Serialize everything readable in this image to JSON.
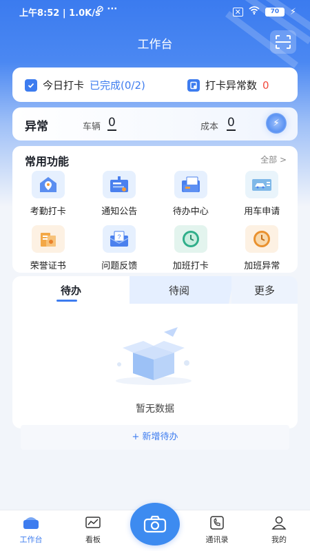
{
  "status_bar": {
    "time_speed": "上午8:52 | 1.0K/s",
    "battery": "70"
  },
  "header": {
    "title": "工作台"
  },
  "checkin": {
    "today_label": "今日打卡",
    "today_status": "已完成(0/2)",
    "abnormal_label": "打卡异常数",
    "abnormal_count": "0"
  },
  "abnormal": {
    "title": "异常",
    "vehicle_label": "车辆",
    "vehicle_value": "0",
    "cost_label": "成本",
    "cost_value": "0"
  },
  "functions": {
    "title": "常用功能",
    "all_label": "全部 >",
    "items": [
      {
        "label": "考勤打卡",
        "icon": "location-pin-icon"
      },
      {
        "label": "通知公告",
        "icon": "notice-board-icon"
      },
      {
        "label": "待办中心",
        "icon": "todo-folder-icon"
      },
      {
        "label": "用车申请",
        "icon": "vehicle-card-icon"
      },
      {
        "label": "荣誉证书",
        "icon": "certificate-icon"
      },
      {
        "label": "问题反馈",
        "icon": "feedback-envelope-icon"
      },
      {
        "label": "加班打卡",
        "icon": "clock-green-icon"
      },
      {
        "label": "加班异常",
        "icon": "clock-orange-icon"
      }
    ]
  },
  "tabs": {
    "items": [
      "待办",
      "待阅",
      "更多"
    ],
    "empty_text": "暂无数据",
    "add_label": "+ 新增待办"
  },
  "bottom_nav": {
    "items": [
      "工作台",
      "看板",
      "通讯录",
      "我的"
    ]
  },
  "colors": {
    "accent": "#3d7cef",
    "alert": "#f24a3d"
  }
}
